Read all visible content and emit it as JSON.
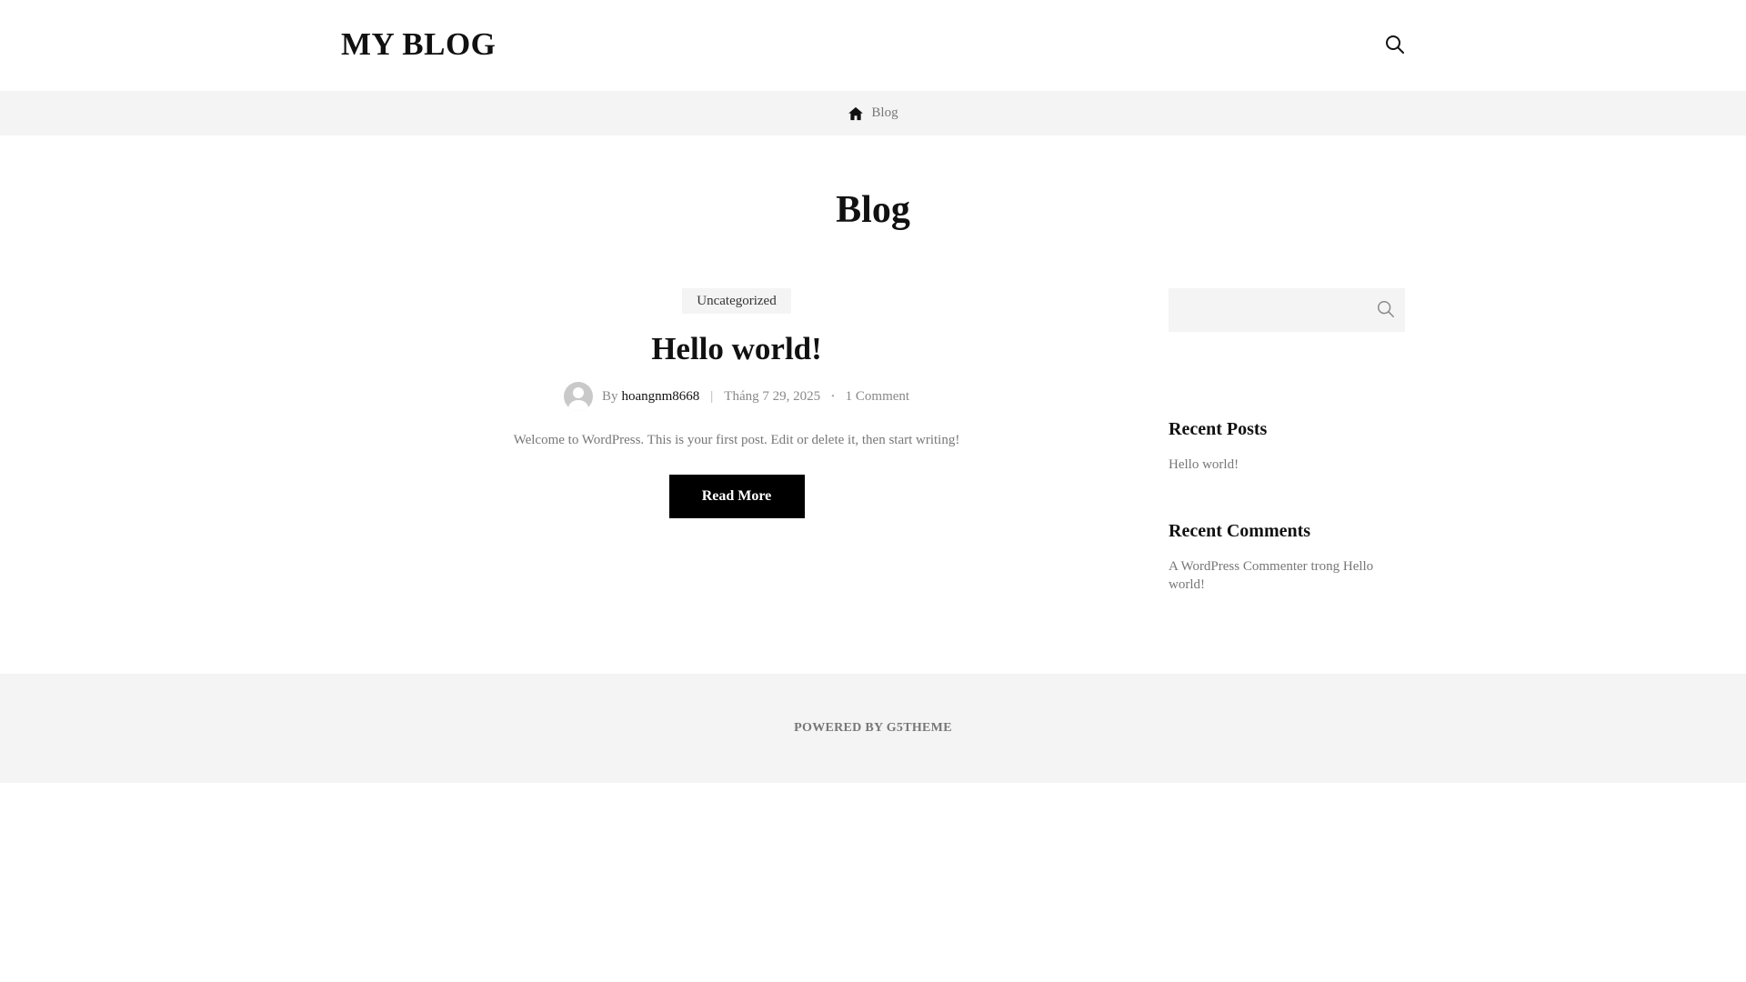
{
  "header": {
    "logo": "MY BLOG",
    "search_icon": "search-icon"
  },
  "breadcrumb": {
    "home_icon": "home-icon",
    "current": "Blog"
  },
  "page": {
    "title": "Blog"
  },
  "post": {
    "category": "Uncategorized",
    "title": "Hello world!",
    "by_label": "By",
    "author": "hoangnm8668",
    "separator": "|",
    "date": "Tháng 7 29, 2025",
    "dot": "•",
    "comments": "1 Comment",
    "excerpt": "Welcome to WordPress. This is your first post. Edit or delete it, then start writing!",
    "read_more": "Read More"
  },
  "sidebar": {
    "search": {
      "placeholder": "",
      "icon": "search-icon"
    },
    "recent_posts": {
      "title": "Recent Posts",
      "items": [
        "Hello world!"
      ]
    },
    "recent_comments": {
      "title": "Recent Comments",
      "author": "A WordPress Commenter",
      "connector": "trong",
      "post": "Hello world!"
    }
  },
  "footer": {
    "text": "POWERED BY G5THEME"
  },
  "colors": {
    "accent": "#000000",
    "bar_background": "#f4f4f4",
    "muted_text": "#777777"
  }
}
